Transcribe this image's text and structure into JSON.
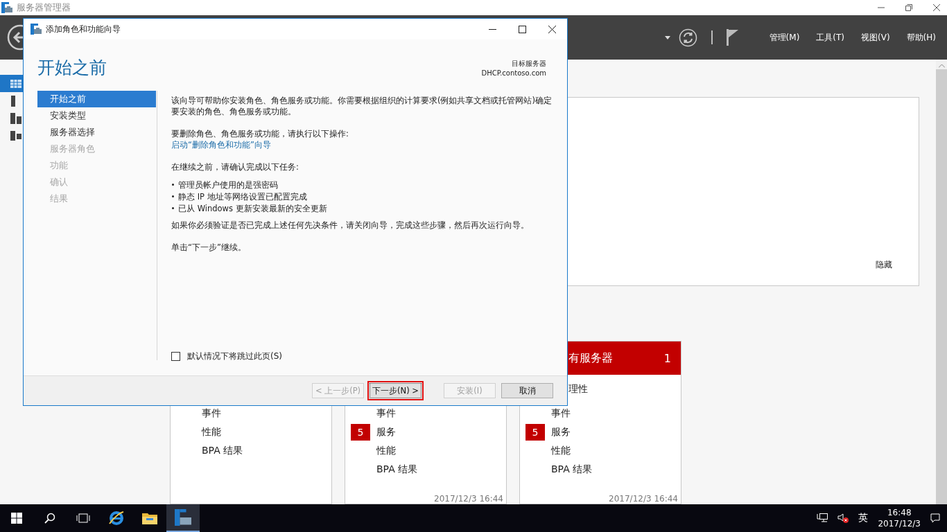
{
  "window": {
    "title": "服务器管理器"
  },
  "toolbar": {
    "menus": [
      "管理(M)",
      "工具(T)",
      "视图(V)",
      "帮助(H)"
    ]
  },
  "welcome_panel": {
    "hide_link": "隐藏"
  },
  "tiles": [
    {
      "rows": [
        {
          "label": "事件"
        },
        {
          "label": "性能"
        },
        {
          "label": "BPA 结果"
        }
      ]
    },
    {
      "rows": [
        {
          "label": "事件"
        },
        {
          "label": "服务",
          "badge": "5"
        },
        {
          "label": "性能"
        },
        {
          "label": "BPA 结果"
        }
      ],
      "timestamp": "2017/12/3 16:44"
    },
    {
      "title": "有服务器",
      "count": "1",
      "top_row": "理性",
      "rows": [
        {
          "label": "事件"
        },
        {
          "label": "服务",
          "badge": "5"
        },
        {
          "label": "性能"
        },
        {
          "label": "BPA 结果"
        }
      ],
      "timestamp": "2017/12/3 16:44"
    }
  ],
  "dialog": {
    "title": "添加角色和功能向导",
    "heading": "开始之前",
    "target_label": "目标服务器",
    "target_server": "DHCP.contoso.com",
    "steps": [
      {
        "label": "开始之前",
        "selected": true,
        "disabled": false
      },
      {
        "label": "安装类型",
        "selected": false,
        "disabled": false
      },
      {
        "label": "服务器选择",
        "selected": false,
        "disabled": false
      },
      {
        "label": "服务器角色",
        "selected": false,
        "disabled": true
      },
      {
        "label": "功能",
        "selected": false,
        "disabled": true
      },
      {
        "label": "确认",
        "selected": false,
        "disabled": true
      },
      {
        "label": "结果",
        "selected": false,
        "disabled": true
      }
    ],
    "intro": "该向导可帮助你安装角色、角色服务或功能。你需要根据组织的计算要求(例如共享文档或托管网站)确定要安装的角色、角色服务或功能。",
    "remove_text": "要删除角色、角色服务或功能，请执行以下操作:",
    "remove_link": "启动“删除角色和功能”向导",
    "tasks_intro": "在继续之前，请确认完成以下任务:",
    "tasks": [
      "管理员帐户使用的是强密码",
      "静态 IP 地址等网络设置已配置完成",
      "已从 Windows 更新安装最新的安全更新"
    ],
    "verify_text": "如果你必须验证是否已完成上述任何先决条件，请关闭向导，完成这些步骤，然后再次运行向导。",
    "continue_text": "单击“下一步”继续。",
    "skip_checkbox": {
      "label": "默认情况下将跳过此页(S)",
      "checked": false
    },
    "buttons": [
      {
        "label": "< 上一步(P)",
        "disabled": true,
        "highlighted": false
      },
      {
        "label": "下一步(N) >",
        "disabled": false,
        "highlighted": true
      },
      {
        "label": "安装(I)",
        "disabled": true,
        "highlighted": false
      },
      {
        "label": "取消",
        "disabled": false,
        "highlighted": false
      }
    ]
  },
  "taskbar": {
    "input_method": "英",
    "time": "16:48",
    "date": "2017/12/3"
  }
}
